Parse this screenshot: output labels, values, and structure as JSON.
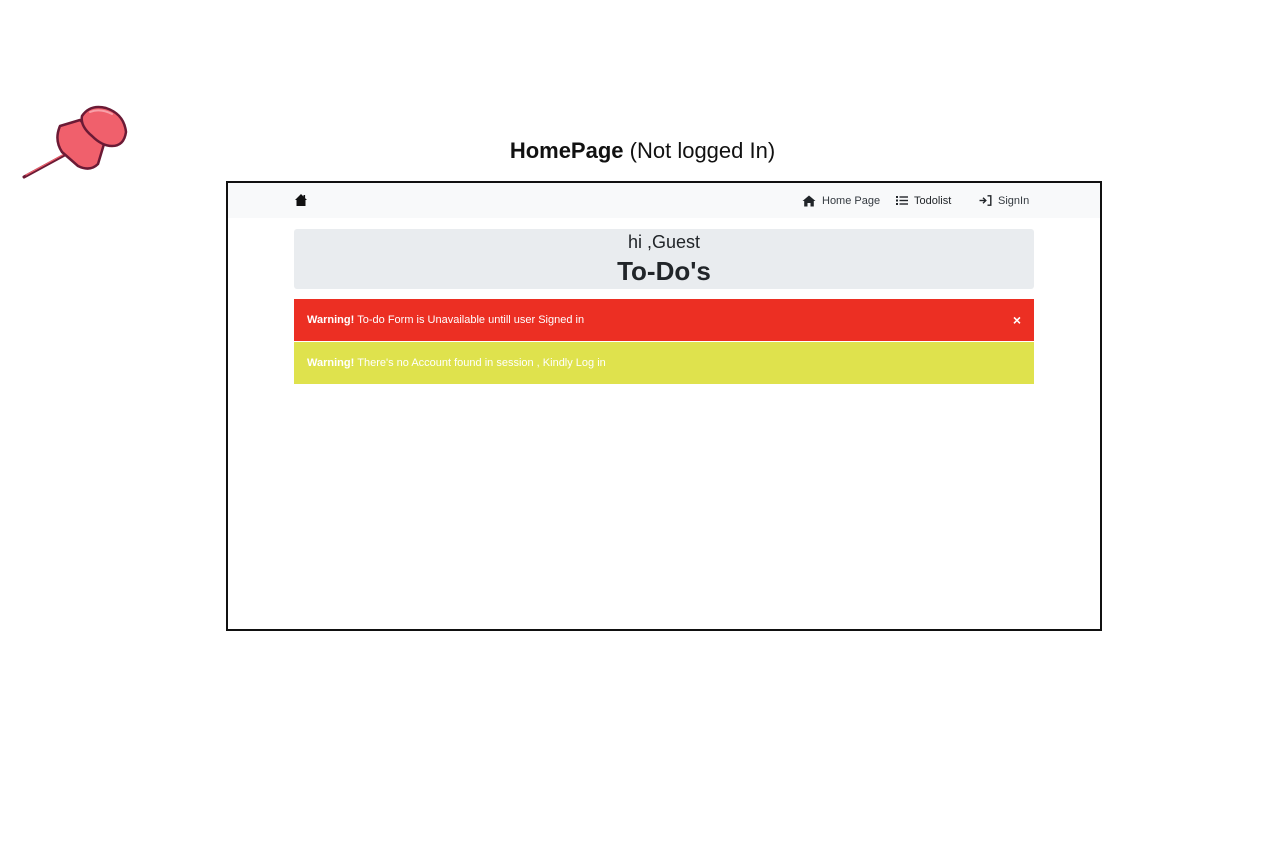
{
  "caption": {
    "bold": "HomePage",
    "rest": " (Not logged In)"
  },
  "colors": {
    "pin": "#f0606c",
    "pin_outline": "#6b1a35",
    "navbar_bg": "#f8f9fa",
    "jumbotron_bg": "#e9ecef",
    "alert_danger": "#ec2f23",
    "alert_warning": "#dfe24d"
  },
  "navbar": {
    "brand_icon": "home-icon",
    "links": [
      {
        "label": "Home Page",
        "icon": "home-icon"
      },
      {
        "label": "Todolist",
        "icon": "list-icon"
      },
      {
        "label": "SignIn",
        "icon": "sign-in-icon"
      }
    ]
  },
  "jumbotron": {
    "greeting": "hi ,Guest",
    "title": "To-Do's"
  },
  "alerts": [
    {
      "strong": "Warning!",
      "text": "To-do Form is Unavailable untill user Signed in",
      "close": "×"
    },
    {
      "strong": "Warning!",
      "text": "There's no Account found in session , Kindly Log in"
    }
  ]
}
